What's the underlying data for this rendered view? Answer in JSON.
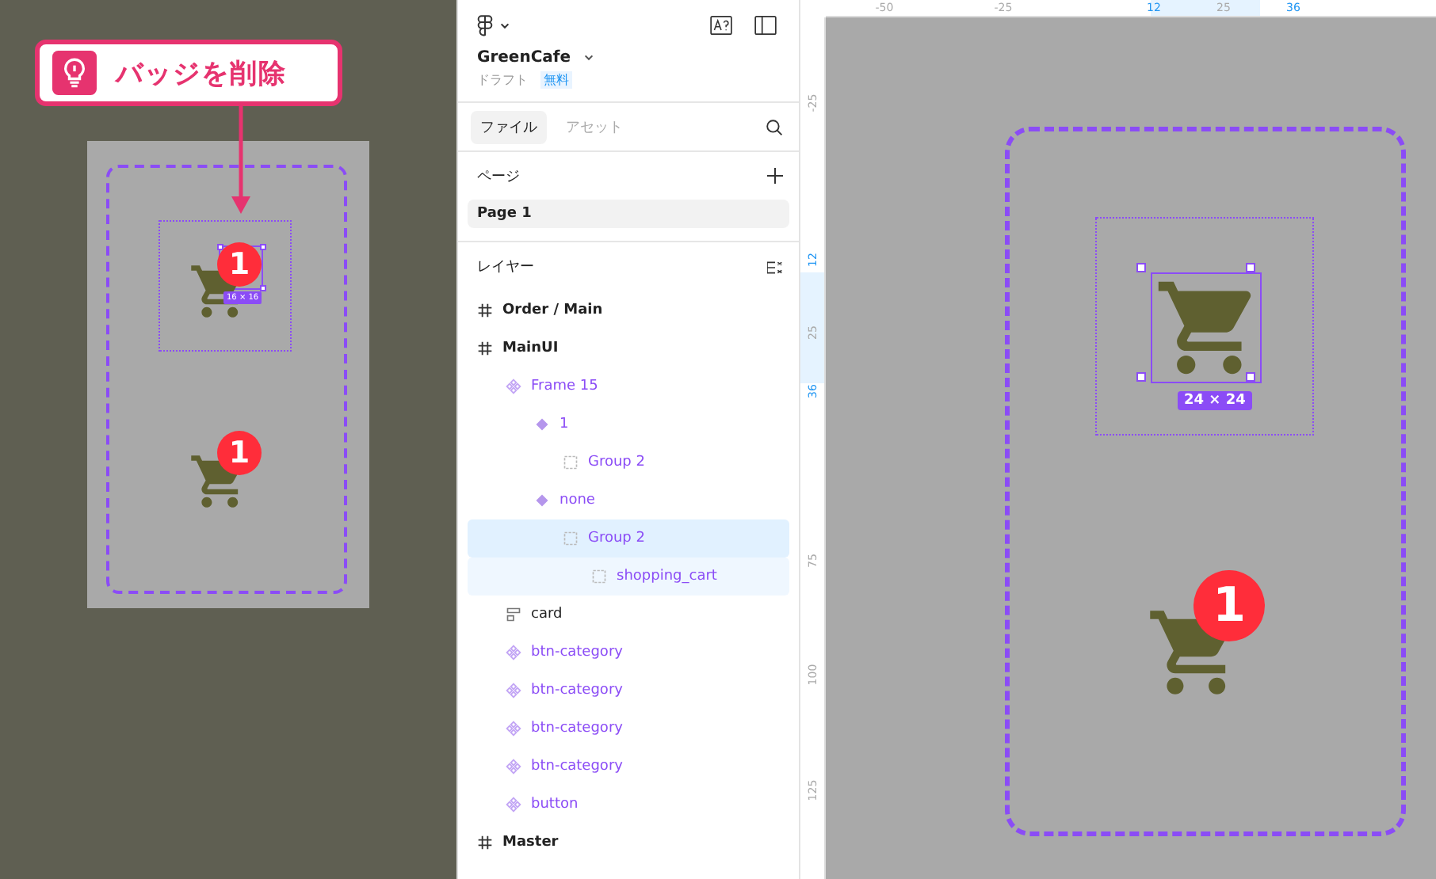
{
  "callout": {
    "text": "バッジを削除"
  },
  "preview": {
    "size_label": "16 × 16",
    "badges": [
      "1",
      "1"
    ]
  },
  "panel": {
    "file_name": "GreenCafe",
    "status": "ドラフト",
    "plan_badge": "無料",
    "tabs": [
      {
        "label": "ファイル",
        "selected": true
      },
      {
        "label": "アセット",
        "selected": false
      }
    ],
    "pages_title": "ページ",
    "pages": [
      {
        "label": "Page 1",
        "selected": true
      }
    ],
    "layers_title": "レイヤー",
    "layers": [
      {
        "name": "Order / Main",
        "kind": "frame",
        "selected": false
      },
      {
        "name": "MainUI",
        "kind": "frame",
        "selected": false,
        "children": [
          {
            "name": "Frame 15",
            "kind": "component",
            "selected": false,
            "children": [
              {
                "name": "1",
                "kind": "variant",
                "selected": false,
                "children": [
                  {
                    "name": "Group 2",
                    "kind": "group",
                    "selected": false
                  }
                ]
              },
              {
                "name": "none",
                "kind": "variant",
                "selected": false,
                "children": [
                  {
                    "name": "Group 2",
                    "kind": "group",
                    "selected": true,
                    "children": [
                      {
                        "name": "shopping_cart",
                        "kind": "group",
                        "selected": false
                      }
                    ]
                  }
                ]
              }
            ]
          },
          {
            "name": "card",
            "kind": "autolayout",
            "selected": false
          },
          {
            "name": "btn-category",
            "kind": "instance",
            "selected": false
          },
          {
            "name": "btn-category",
            "kind": "instance",
            "selected": false
          },
          {
            "name": "btn-category",
            "kind": "instance",
            "selected": false
          },
          {
            "name": "btn-category",
            "kind": "instance",
            "selected": false
          },
          {
            "name": "button",
            "kind": "instance",
            "selected": false
          }
        ]
      },
      {
        "name": "Master",
        "kind": "frame",
        "selected": false
      }
    ]
  },
  "canvas": {
    "ruler_top": [
      {
        "label": "-50",
        "highlighted": false
      },
      {
        "label": "-25",
        "highlighted": false
      },
      {
        "label": "12",
        "highlighted": true
      },
      {
        "label": "25",
        "highlighted": false
      },
      {
        "label": "36",
        "highlighted": true
      }
    ],
    "ruler_left": [
      {
        "label": "-25",
        "highlighted": false
      },
      {
        "label": "12",
        "highlighted": true
      },
      {
        "label": "25",
        "highlighted": false
      },
      {
        "label": "36",
        "highlighted": true
      },
      {
        "label": "75",
        "highlighted": false
      },
      {
        "label": "100",
        "highlighted": false
      },
      {
        "label": "125",
        "highlighted": false
      }
    ],
    "size_label": "24 × 24",
    "badge": "1"
  }
}
